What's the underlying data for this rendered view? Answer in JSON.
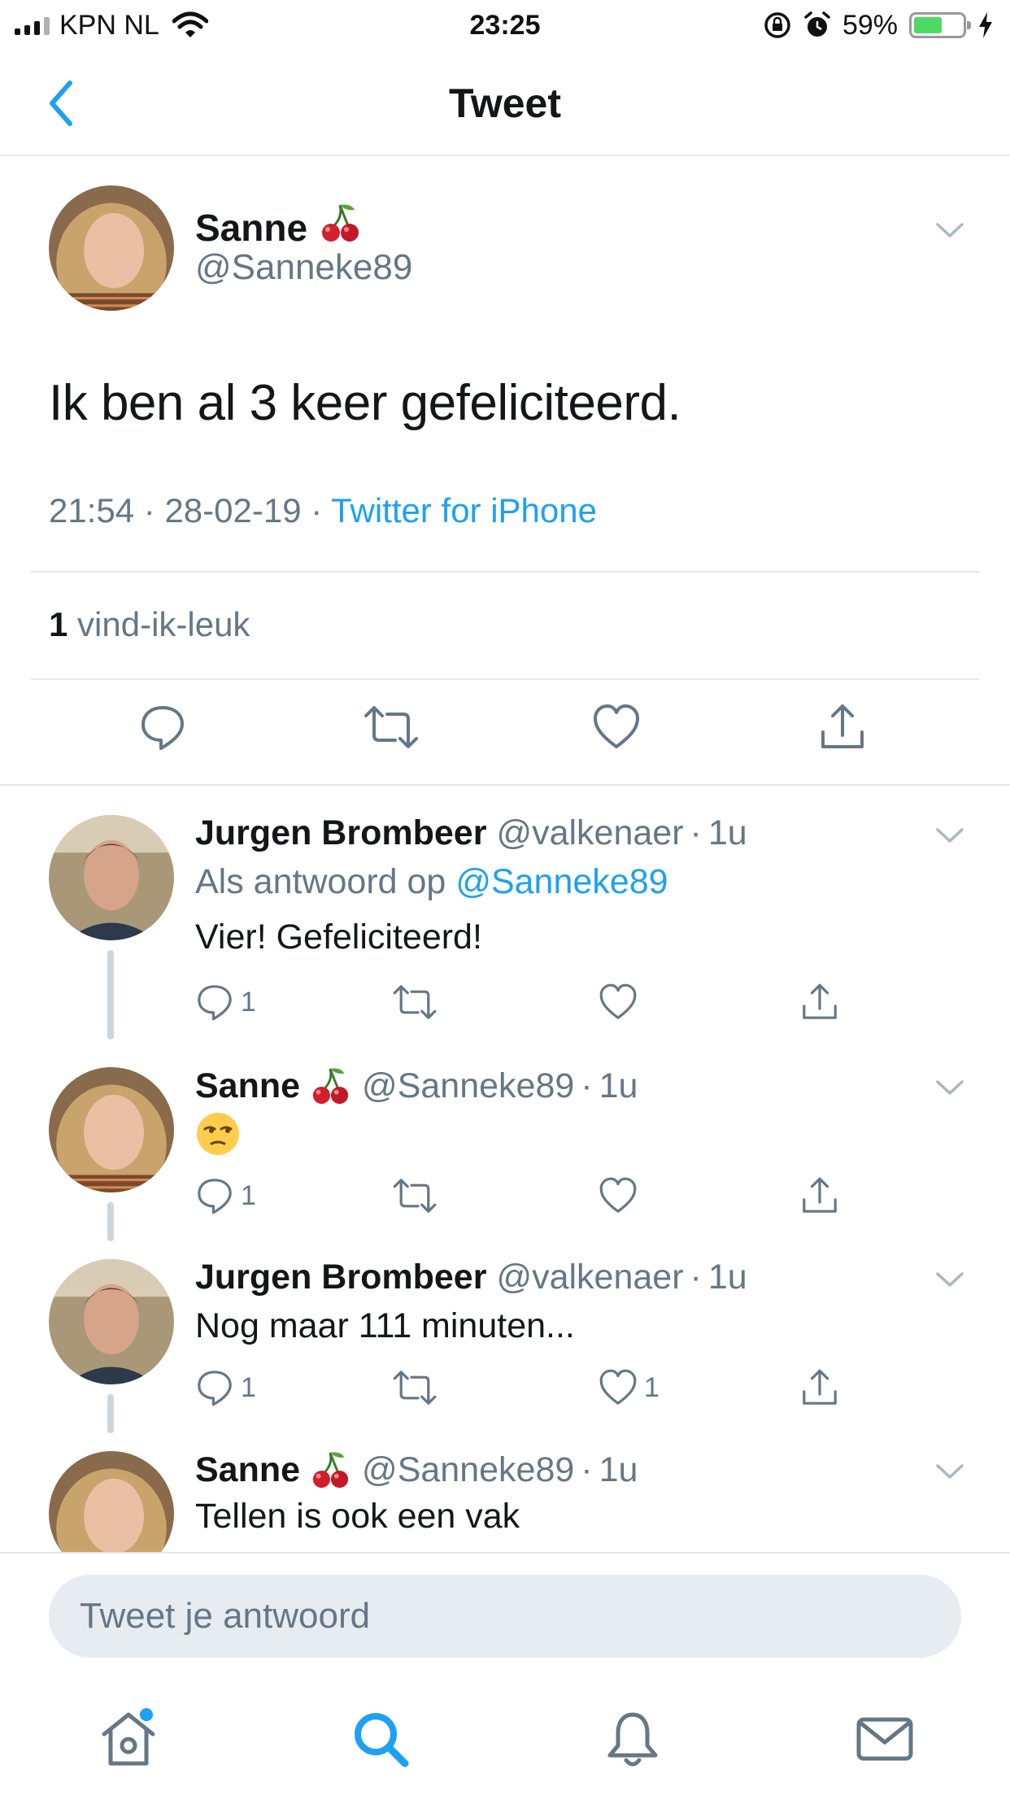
{
  "status_bar": {
    "carrier": "KPN NL",
    "time": "23:25",
    "battery_percent": "59%",
    "battery_level": 0.59,
    "icons": [
      "signal-icon",
      "wifi-icon",
      "rotation-lock-icon",
      "alarm-icon",
      "battery-icon",
      "charging-icon"
    ]
  },
  "nav": {
    "title": "Tweet",
    "back_icon": "chevron-left-icon"
  },
  "main_tweet": {
    "name": "Sanne",
    "name_emoji": "cherry-emoji",
    "handle": "@Sanneke89",
    "text": "Ik ben al 3 keer gefeliciteerd.",
    "time": "21:54",
    "separator": "·",
    "date": "28-02-19",
    "source": "Twitter for iPhone",
    "likes_count": "1",
    "likes_label": "vind-ik-leuk"
  },
  "replies": [
    {
      "name": "Jurgen Brombeer",
      "handle": "@valkenaer",
      "time": "1u",
      "reply_to_label": "Als antwoord op",
      "reply_to_handle": "@Sanneke89",
      "text": "Vier! Gefeliciteerd!",
      "reply_count": "1",
      "like_count": ""
    },
    {
      "name": "Sanne",
      "handle": "@Sanneke89",
      "time": "1u",
      "text": "",
      "emoji": "unamused-face-emoji",
      "reply_count": "1",
      "like_count": ""
    },
    {
      "name": "Jurgen Brombeer",
      "handle": "@valkenaer",
      "time": "1u",
      "text": "Nog maar 111 minuten...",
      "reply_count": "1",
      "like_count": "1"
    },
    {
      "name": "Sanne",
      "handle": "@Sanneke89",
      "time": "1u",
      "text": "Tellen is ook een vak"
    }
  ],
  "composer": {
    "placeholder": "Tweet je antwoord"
  },
  "tabs": [
    {
      "name": "home",
      "icon": "home-icon",
      "has_notification_dot": true
    },
    {
      "name": "search",
      "icon": "search-icon",
      "active": true
    },
    {
      "name": "notifications",
      "icon": "bell-icon"
    },
    {
      "name": "messages",
      "icon": "mail-icon"
    }
  ],
  "colors": {
    "accent": "#1da1f2",
    "text": "#14171a",
    "secondary": "#657786",
    "divider": "#e1e8ed"
  }
}
